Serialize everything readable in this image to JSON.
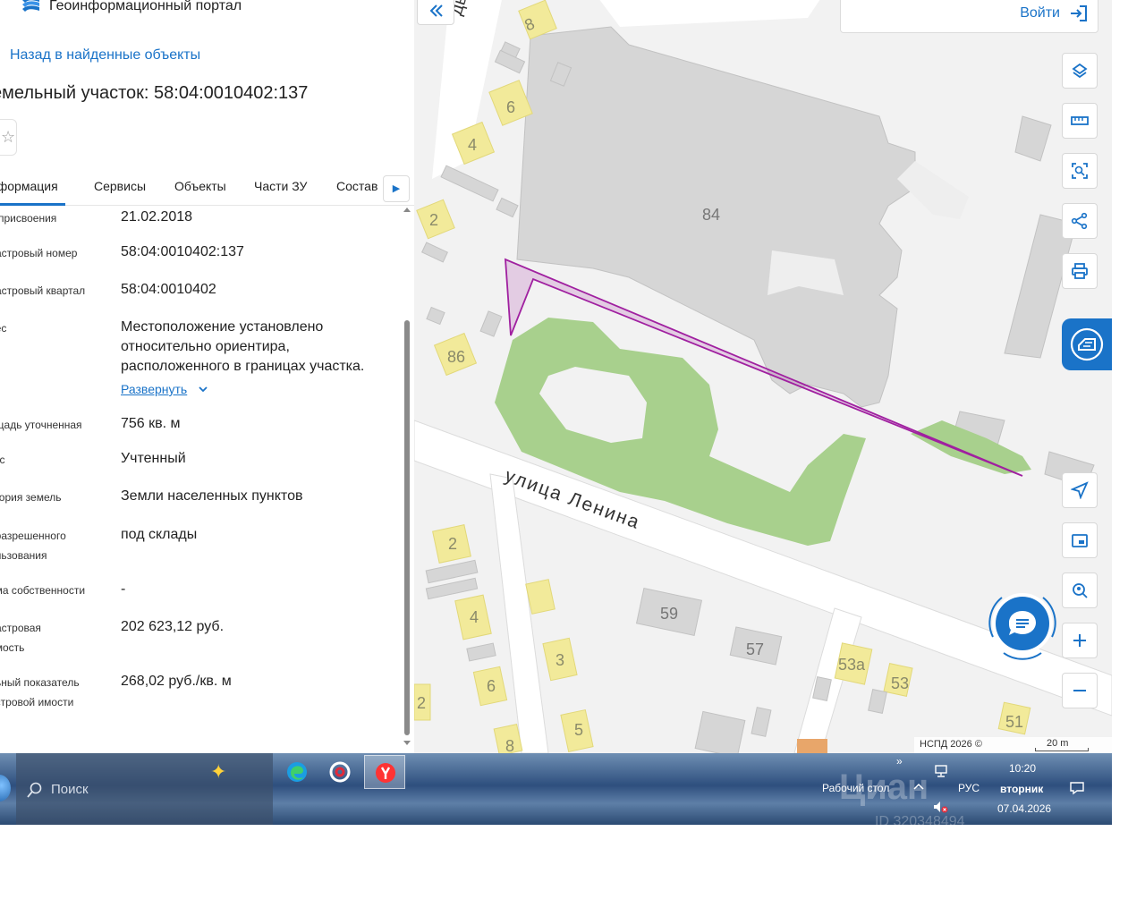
{
  "header": {
    "portal_title": "Геоинформационный портал",
    "back_link": "Назад в найденные объекты",
    "parcel_title": "емельный участок: 58:04:0010402:137"
  },
  "tabs": {
    "info": "нформация",
    "services": "Сервисы",
    "objects": "Объекты",
    "parts": "Части ЗУ",
    "composition": "Состав"
  },
  "details": {
    "rows": [
      {
        "label": "а присвоения",
        "value": "21.02.2018"
      },
      {
        "label": "дастровый номер",
        "value": "58:04:0010402:137"
      },
      {
        "label": "дастровый квартал",
        "value": "58:04:0010402"
      },
      {
        "label": "рес",
        "value": "Местоположение установлено относительно ориентира, расположенного в границах участка."
      },
      {
        "label": "ощадь уточненная",
        "value": "756 кв. м"
      },
      {
        "label": "тус",
        "value": "Учтенный"
      },
      {
        "label": "егория земель",
        "value": "Земли населенных пунктов"
      },
      {
        "label": ", разрешенного ользования",
        "value": "под склады"
      },
      {
        "label": "рма собственности",
        "value": "-"
      },
      {
        "label": "дастровая имость",
        "value": "202 623,12 руб."
      },
      {
        "label": "льный показатель астровой имости",
        "value": "268,02 руб./кв. м"
      }
    ],
    "expand_link": "Развернуть"
  },
  "map": {
    "login_label": "Войти",
    "street_label": "улица Ленина",
    "street_label_top": "ды у",
    "building_numbers": {
      "b8": "8",
      "b6": "6",
      "b4": "4",
      "b2": "2",
      "b84": "84",
      "b86": "86",
      "s2": "2",
      "s4": "4",
      "s3": "3",
      "s6": "6",
      "s5": "5",
      "s8": "8",
      "s59": "59",
      "s57": "57",
      "s53a": "53а",
      "s53": "53",
      "s51": "51",
      "s2x": "2"
    },
    "attribution": "НСПД 2026 ©",
    "scale": "20 m",
    "colors": {
      "parcel": "#a020a0",
      "greenery": "#a8d08d",
      "buildings": "#d6d6d6",
      "residential": "#f2ea9a"
    }
  },
  "taskbar": {
    "search_placeholder": "Поиск",
    "desktop_label": "Рабочий стол",
    "desktop_arrows": "»",
    "language": "РУС",
    "time": "10:20",
    "day": "вторник",
    "date": "07.04.2026",
    "watermark_brand": "Циан",
    "watermark_id": "ID 320348494"
  },
  "icons": [
    "logo-icon",
    "star-icon",
    "chevron-right-icon",
    "chevron-down-icon",
    "double-chevron-left-icon",
    "login-icon",
    "layers-icon",
    "ruler-icon",
    "select-area-icon",
    "share-icon",
    "print-icon",
    "eds-icon",
    "locate-icon",
    "minimap-icon",
    "search-location-icon",
    "zoom-in-icon",
    "zoom-out-icon",
    "chat-icon",
    "search-icon",
    "edge-icon",
    "c-app-icon",
    "yandex-icon",
    "network-icon",
    "volume-muted-icon",
    "notification-icon"
  ]
}
